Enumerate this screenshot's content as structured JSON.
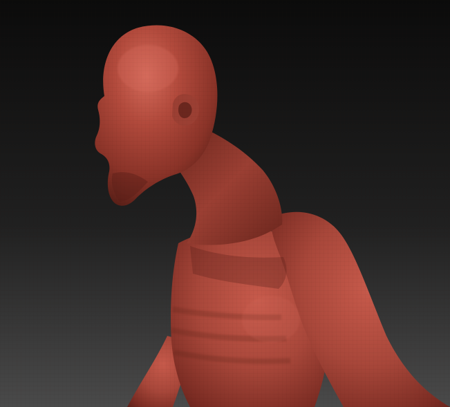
{
  "viewport": {
    "background_top": "#0b0b0b",
    "background_bottom": "#4a4a4a",
    "material_base": "#9b3f33",
    "material_highlight": "#d56b5b",
    "material_shadow": "#5b2018",
    "mesh_wire": "#2b0f0b",
    "model": "sculpted-gaunt-humanoid-bust"
  }
}
